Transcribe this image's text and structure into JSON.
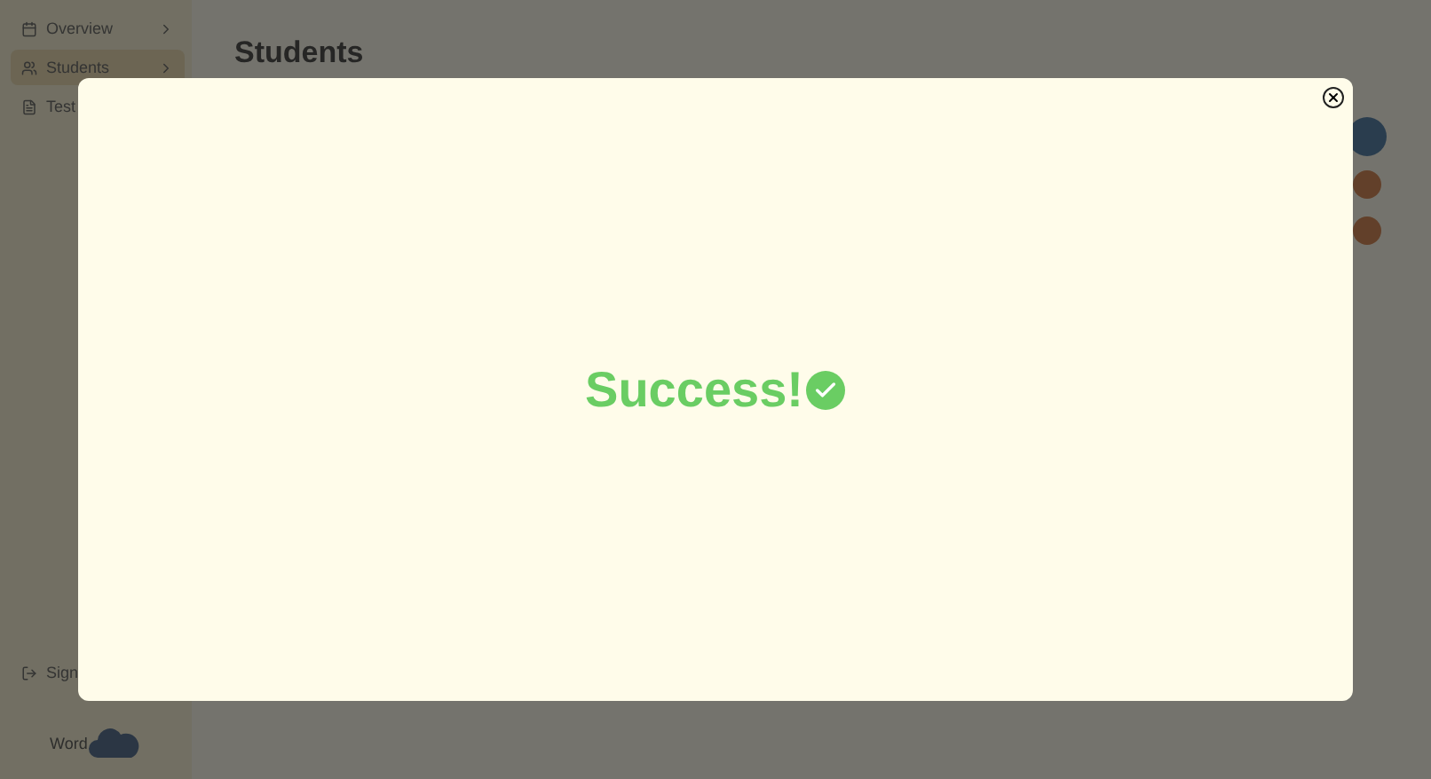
{
  "sidebar": {
    "items": [
      {
        "label": "Overview",
        "kind": "expandable",
        "selected": false
      },
      {
        "label": "Students",
        "kind": "expandable",
        "selected": true
      },
      {
        "label": "Test",
        "kind": "plain",
        "selected": false
      }
    ],
    "sign_out": {
      "label": "Sign"
    },
    "logo": {
      "label": "Word"
    }
  },
  "page": {
    "title": "Students"
  },
  "modal": {
    "message": "Success!"
  }
}
